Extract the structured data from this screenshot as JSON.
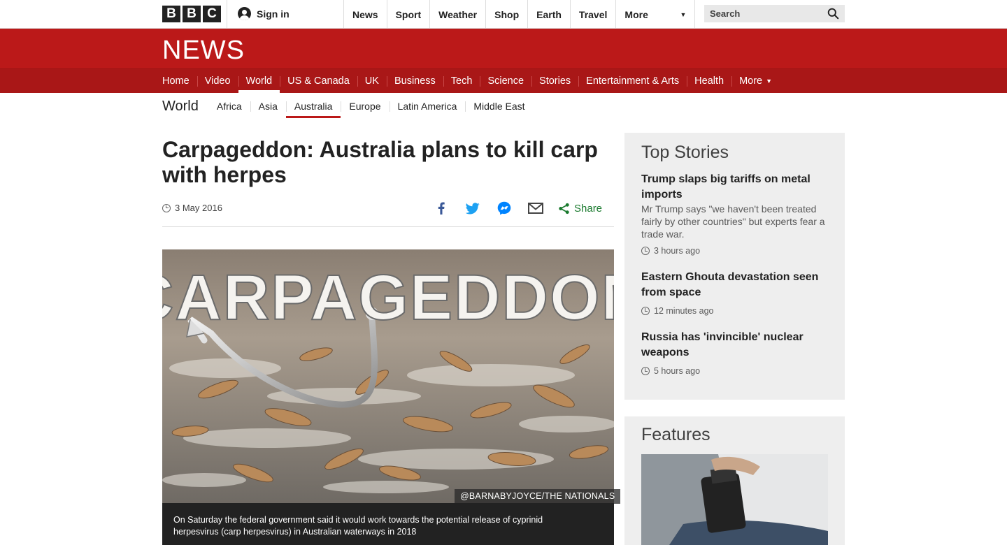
{
  "bbc_logo": [
    "B",
    "B",
    "C"
  ],
  "topbar": {
    "signin_label": "Sign in",
    "nav": [
      "News",
      "Sport",
      "Weather",
      "Shop",
      "Earth",
      "Travel"
    ],
    "more_label": "More",
    "search_placeholder": "Search"
  },
  "masthead": {
    "logo": "NEWS"
  },
  "mainnav": {
    "items": [
      "Home",
      "Video",
      "World",
      "US & Canada",
      "UK",
      "Business",
      "Tech",
      "Science",
      "Stories",
      "Entertainment & Arts",
      "Health"
    ],
    "more_label": "More",
    "active": "World"
  },
  "subnav": {
    "section": "World",
    "items": [
      "Africa",
      "Asia",
      "Australia",
      "Europe",
      "Latin America",
      "Middle East"
    ],
    "active": "Australia"
  },
  "article": {
    "headline": "Carpageddon: Australia plans to kill carp with herpes",
    "date": "3 May 2016",
    "share_label": "Share",
    "share_icons": [
      "facebook-icon",
      "twitter-icon",
      "messenger-icon",
      "email-icon",
      "share-icon"
    ],
    "image_overlay_text": "CARPAGEDDON",
    "image_credit": "@BARNABYJOYCE/THE NATIONALS",
    "caption": "On Saturday the federal government said it would work towards the potential release of cyprinid herpesvirus (carp herpesvirus) in Australian waterways in 2018"
  },
  "top_stories": {
    "title": "Top Stories",
    "stories": [
      {
        "title": "Trump slaps big tariffs on metal imports",
        "summary": "Mr Trump says \"we haven't been treated fairly by other countries\" but experts fear a trade war.",
        "time": "3 hours ago"
      },
      {
        "title": "Eastern Ghouta devastation seen from space",
        "summary": "",
        "time": "12 minutes ago"
      },
      {
        "title": "Russia has 'invincible' nuclear weapons",
        "summary": "",
        "time": "5 hours ago"
      }
    ]
  },
  "features": {
    "title": "Features"
  },
  "colors": {
    "brand_red": "#bb1919",
    "nav_red": "#a91717",
    "share_green": "#1a7a2e",
    "facebook": "#3b5998",
    "twitter": "#1da1f2",
    "messenger": "#0084ff"
  }
}
